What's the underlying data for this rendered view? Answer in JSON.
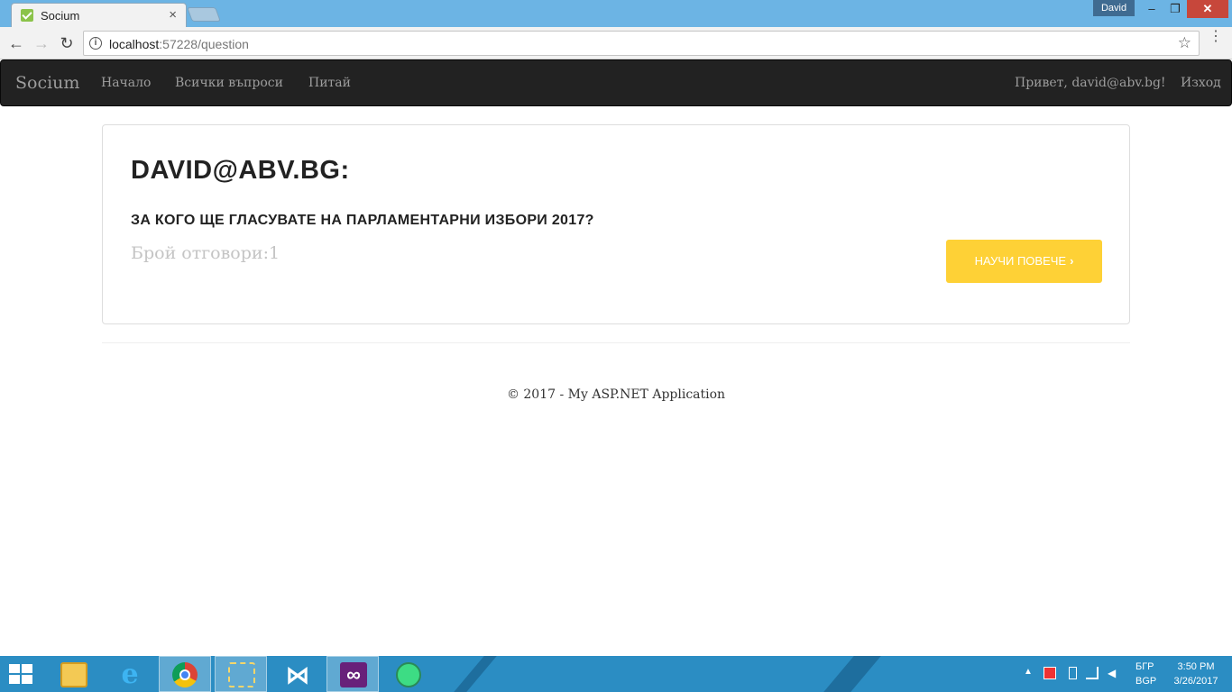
{
  "browser": {
    "tab_title": "Socium",
    "tab_close": "×",
    "profile_name": "David",
    "window_controls": {
      "minimize": "–",
      "maximize": "❐",
      "close": "✕"
    },
    "nav": {
      "back": "←",
      "forward": "→",
      "reload": "↻"
    },
    "url_host": "localhost",
    "url_path": ":57228/question",
    "info_symbol": "i",
    "star_symbol": "☆",
    "menu_symbol": "⋮"
  },
  "navbar": {
    "brand": "Socium",
    "links": [
      "Начало",
      "Всички въпроси",
      "Питай"
    ],
    "greeting": "Привет, david@abv.bg!",
    "logout": "Изход"
  },
  "question_card": {
    "author": "DAVID@ABV.BG:",
    "question": "ЗА КОГО ЩЕ ГЛАСУВАТЕ НА ПАРЛАМЕНТАРНИ ИЗБОРИ 2017?",
    "answers_count": "Брой отговори:1",
    "learn_more": "НАУЧИ ПОВЕЧЕ",
    "learn_more_chevron": "›"
  },
  "footer": {
    "text": "© 2017 - My ASP.NET Application"
  },
  "taskbar": {
    "apps": [
      "start-icon",
      "file-explorer-icon",
      "internet-explorer-icon",
      "chrome-icon",
      "tool-icon",
      "vscode-icon",
      "visual-studio-icon",
      "android-studio-icon"
    ],
    "tray_up": "▲",
    "lang_top": "БГР",
    "lang_bottom": "BGP",
    "time": "3:50 PM",
    "date": "3/26/2017"
  },
  "colors": {
    "navbar_bg": "#222222",
    "accent_button": "#fed136",
    "taskbar_bg": "#2b8dc3",
    "titlebar_bg": "#6cb4e4"
  }
}
